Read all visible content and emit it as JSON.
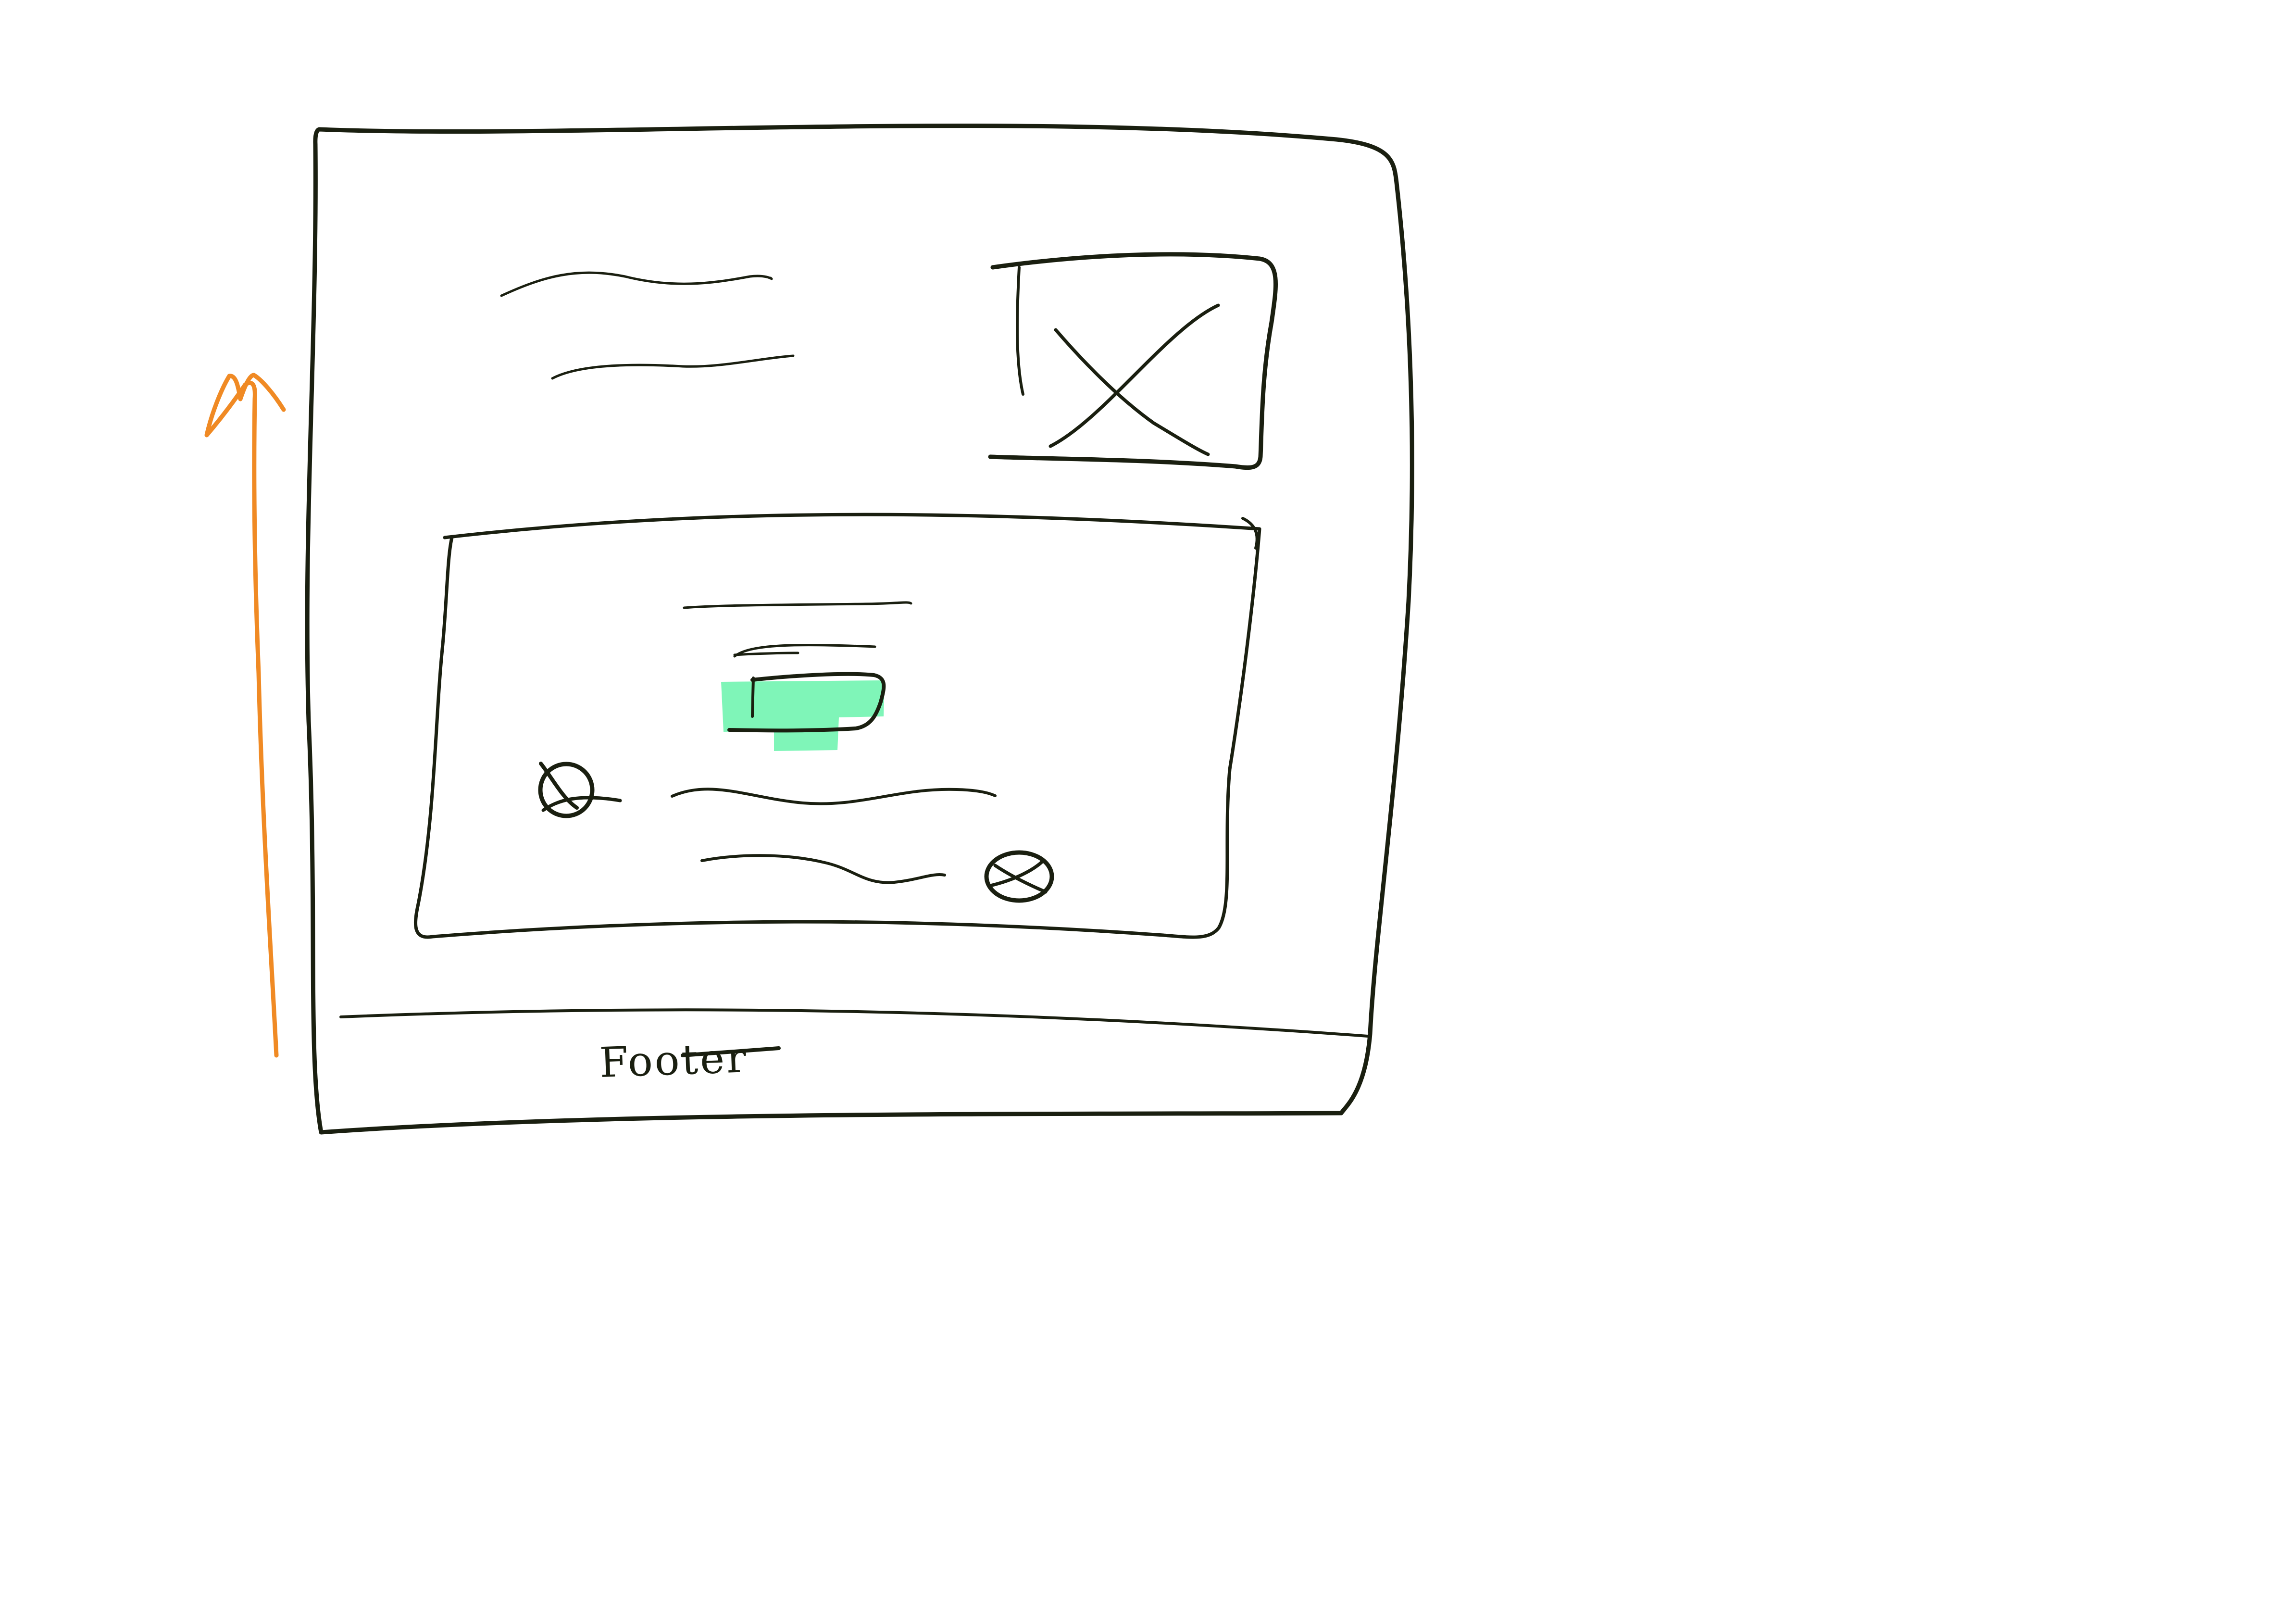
{
  "footer": {
    "label": "Footer"
  },
  "colors": {
    "ink": "#1a1f10",
    "arrow": "#f08a24",
    "highlight": "#7ff5b8",
    "background": "#ffffff"
  },
  "icons": {
    "image_placeholder": "crossed-box-icon",
    "left_control": "circle-x-icon",
    "right_control": "circle-x-icon",
    "scroll_direction": "up-arrow-icon"
  }
}
